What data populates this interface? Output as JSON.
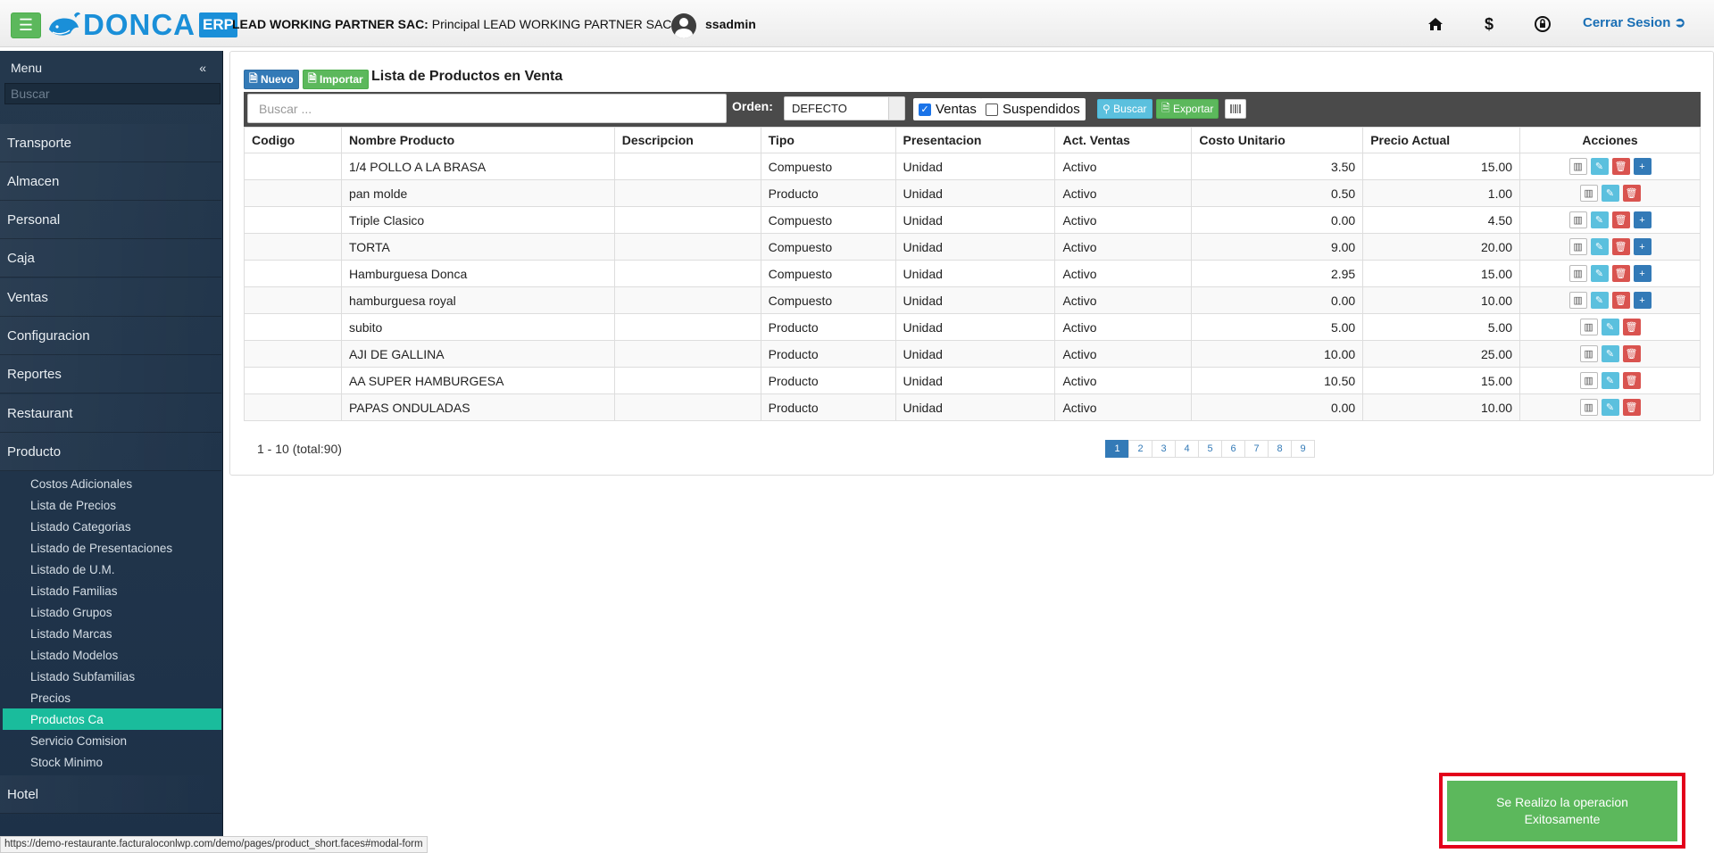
{
  "header": {
    "logo_text": "DONCA",
    "logo_badge": "ERP",
    "company_label": "LEAD WORKING PARTNER SAC:",
    "company_value": "Principal LEAD WORKING PARTNER SAC |",
    "username": "ssadmin",
    "logout_label": "Cerrar Sesion",
    "icons": [
      "home-icon",
      "dollar-icon",
      "lock-icon",
      "logout-icon"
    ]
  },
  "sidebar": {
    "title": "Menu",
    "search_placeholder": "Buscar",
    "items": [
      "Transporte",
      "Almacen",
      "Personal",
      "Caja",
      "Ventas",
      "Configuracion",
      "Reportes",
      "Restaurant",
      "Producto",
      "Hotel"
    ],
    "sub_items": [
      "Costos Adicionales",
      "Lista de Precios",
      "Listado Categorias",
      "Listado de Presentaciones",
      "Listado de U.M.",
      "Listado Familias",
      "Listado Grupos",
      "Listado Marcas",
      "Listado Modelos",
      "Listado Subfamilias",
      "Precios",
      "Productos Ca",
      "Servicio Comision",
      "Stock Minimo"
    ],
    "active_sub_item": "Productos Ca"
  },
  "main": {
    "btn_nuevo": "Nuevo",
    "btn_importar": "Importar",
    "title": "Lista de Productos en Venta",
    "search_placeholder": "Buscar ...",
    "orden_label": "Orden:",
    "orden_value": "DEFECTO",
    "chk_ventas": "Ventas",
    "chk_ventas_checked": true,
    "chk_suspendidos": "Suspendidos",
    "chk_suspendidos_checked": false,
    "btn_buscar": "Buscar",
    "btn_exportar": "Exportar",
    "columns": [
      "Codigo",
      "Nombre Producto",
      "Descripcion",
      "Tipo",
      "Presentacion",
      "Act. Ventas",
      "Costo Unitario",
      "Precio Actual",
      "Acciones"
    ],
    "rows": [
      {
        "codigo": "",
        "nombre": "1/4 POLLO A LA BRASA",
        "descripcion": "",
        "tipo": "Compuesto",
        "presentacion": "Unidad",
        "act": "Activo",
        "costo": "3.50",
        "precio": "15.00"
      },
      {
        "codigo": "",
        "nombre": "pan molde",
        "descripcion": "",
        "tipo": "Producto",
        "presentacion": "Unidad",
        "act": "Activo",
        "costo": "0.50",
        "precio": "1.00"
      },
      {
        "codigo": "",
        "nombre": "Triple Clasico",
        "descripcion": "",
        "tipo": "Compuesto",
        "presentacion": "Unidad",
        "act": "Activo",
        "costo": "0.00",
        "precio": "4.50"
      },
      {
        "codigo": "",
        "nombre": "TORTA",
        "descripcion": "",
        "tipo": "Compuesto",
        "presentacion": "Unidad",
        "act": "Activo",
        "costo": "9.00",
        "precio": "20.00"
      },
      {
        "codigo": "",
        "nombre": "Hamburguesa Donca",
        "descripcion": "",
        "tipo": "Compuesto",
        "presentacion": "Unidad",
        "act": "Activo",
        "costo": "2.95",
        "precio": "15.00"
      },
      {
        "codigo": "",
        "nombre": "hamburguesa royal",
        "descripcion": "",
        "tipo": "Compuesto",
        "presentacion": "Unidad",
        "act": "Activo",
        "costo": "0.00",
        "precio": "10.00"
      },
      {
        "codigo": "",
        "nombre": "subito",
        "descripcion": "",
        "tipo": "Producto",
        "presentacion": "Unidad",
        "act": "Activo",
        "costo": "5.00",
        "precio": "5.00"
      },
      {
        "codigo": "",
        "nombre": "AJI DE GALLINA",
        "descripcion": "",
        "tipo": "Producto",
        "presentacion": "Unidad",
        "act": "Activo",
        "costo": "10.00",
        "precio": "25.00"
      },
      {
        "codigo": "",
        "nombre": "AA SUPER HAMBURGESA",
        "descripcion": "",
        "tipo": "Producto",
        "presentacion": "Unidad",
        "act": "Activo",
        "costo": "10.50",
        "precio": "15.00"
      },
      {
        "codigo": "",
        "nombre": "PAPAS ONDULADAS",
        "descripcion": "",
        "tipo": "Producto",
        "presentacion": "Unidad",
        "act": "Activo",
        "costo": "0.00",
        "precio": "10.00"
      }
    ],
    "pager_info": "1 - 10 (total:90)",
    "pages": [
      "1",
      "2",
      "3",
      "4",
      "5",
      "6",
      "7",
      "8",
      "9"
    ],
    "active_page": "1"
  },
  "toast": {
    "message_line1": "Se Realizo la operacion",
    "message_line2": "Exitosamente"
  },
  "status_bar": "https://demo-restaurante.facturaloconlwp.com/demo/pages/product_short.faces#modal-form",
  "colors": {
    "brand": "#1a8fd8",
    "sidebar_bg": "#24384d",
    "active_sub": "#1abc9c",
    "toast_bg": "#5cb85c",
    "highlight_border": "#e3001b"
  }
}
